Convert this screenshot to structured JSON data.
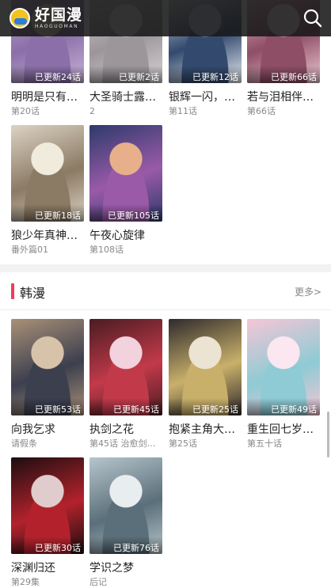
{
  "header": {
    "logo_text": "好国漫",
    "logo_subtext": "HAOGUOMAN",
    "search_icon": "search-icon"
  },
  "top_grid": [
    {
      "badge": "已更新24话",
      "title": "明明是只有…",
      "sub": "第20话",
      "colors": [
        "#c9b4d6",
        "#8a6fa8",
        "#f2e3c5"
      ]
    },
    {
      "badge": "已更新2话",
      "title": "大圣骑士露…",
      "sub": "2",
      "colors": [
        "#d6d2d4",
        "#9c969a",
        "#efefef"
      ]
    },
    {
      "badge": "已更新12话",
      "title": "银辉一闪，…",
      "sub": "第11话",
      "colors": [
        "#e9edf3",
        "#334a6e",
        "#c4cde0"
      ]
    },
    {
      "badge": "已更新66话",
      "title": "若与泪相伴…",
      "sub": "第66话",
      "colors": [
        "#eec9d4",
        "#8e4e66",
        "#f6e6ea"
      ]
    },
    {
      "badge": "已更新18话",
      "title": "狼少年真神…",
      "sub": "番外篇01",
      "colors": [
        "#dcd3c4",
        "#8b7a64",
        "#f1ebde"
      ]
    },
    {
      "badge": "已更新105话",
      "title": "午夜心旋律",
      "sub": "第108话",
      "colors": [
        "#2d3a6b",
        "#9a5aa8",
        "#e8b08a"
      ]
    }
  ],
  "section": {
    "title": "韩漫",
    "more": "更多>"
  },
  "korean_grid": [
    {
      "badge": "已更新53话",
      "title": "向我乞求",
      "sub": "请假条",
      "colors": [
        "#a99178",
        "#3c3f4e",
        "#d7c3a9"
      ]
    },
    {
      "badge": "已更新45话",
      "title": "执剑之花",
      "sub": "第45话 治愈剑出…",
      "colors": [
        "#4a1c22",
        "#c23a4a",
        "#f2d2dc"
      ]
    },
    {
      "badge": "已更新25话",
      "title": "抱紧主角大…",
      "sub": "第25话",
      "colors": [
        "#2f2a2c",
        "#c9b06a",
        "#ece4d2"
      ]
    },
    {
      "badge": "已更新49话",
      "title": "重生回七岁…",
      "sub": "第五十话",
      "colors": [
        "#f5c6d6",
        "#8ecbd4",
        "#fbe7ef"
      ]
    },
    {
      "badge": "已更新30话",
      "title": "深渊归还",
      "sub": "第29集",
      "colors": [
        "#1c0e10",
        "#b3222c",
        "#e0cccc"
      ]
    },
    {
      "badge": "已更新76话",
      "title": "学识之梦",
      "sub": "后记",
      "colors": [
        "#b7c5cc",
        "#5a6f7a",
        "#e8edf0"
      ]
    }
  ]
}
